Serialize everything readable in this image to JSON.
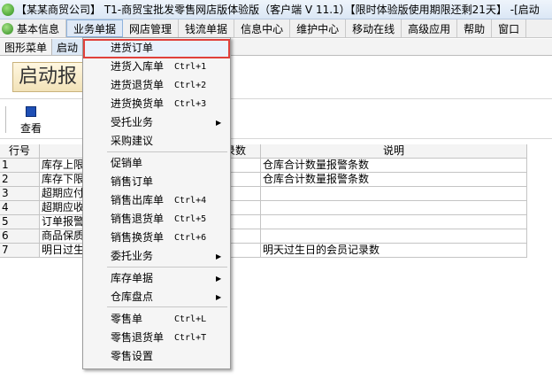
{
  "window": {
    "title": "【某某商贸公司】 T1-商贸宝批发零售网店版体验版（客户端 V 11.1）【限时体验版使用期限还剩21天】 -[启动"
  },
  "menubar": {
    "items": [
      "基本信息",
      "业务单据",
      "网店管理",
      "钱流单据",
      "信息中心",
      "维护中心",
      "移动在线",
      "高级应用",
      "帮助",
      "窗口"
    ]
  },
  "tabs": [
    "图形菜单",
    "启动"
  ],
  "banner": {
    "text": "启动报"
  },
  "toolbar": {
    "view_label": "查看"
  },
  "table": {
    "headers": {
      "row_no": "行号",
      "count": "录数",
      "desc": "说明"
    },
    "rows": [
      {
        "no": "1",
        "name": "库存上限",
        "desc": "仓库合计数量报警条数"
      },
      {
        "no": "2",
        "name": "库存下限",
        "desc": "仓库合计数量报警条数"
      },
      {
        "no": "3",
        "name": "超期应付",
        "desc": ""
      },
      {
        "no": "4",
        "name": "超期应收",
        "desc": ""
      },
      {
        "no": "5",
        "name": "订单报警",
        "desc": ""
      },
      {
        "no": "6",
        "name": "商品保质",
        "desc": ""
      },
      {
        "no": "7",
        "name": "明日过生",
        "desc": "明天过生日的会员记录数"
      }
    ]
  },
  "dropdown": {
    "items": [
      {
        "label": "进货订单",
        "shortcut": "",
        "submenu": false,
        "highlighted": true
      },
      {
        "label": "进货入库单",
        "shortcut": "Ctrl+1",
        "submenu": false
      },
      {
        "label": "进货退货单",
        "shortcut": "Ctrl+2",
        "submenu": false
      },
      {
        "label": "进货换货单",
        "shortcut": "Ctrl+3",
        "submenu": false
      },
      {
        "label": "受托业务",
        "shortcut": "",
        "submenu": true
      },
      {
        "label": "采购建议",
        "shortcut": "",
        "submenu": false
      },
      {
        "label": "促销单",
        "shortcut": "",
        "submenu": false
      },
      {
        "label": "销售订单",
        "shortcut": "",
        "submenu": false
      },
      {
        "label": "销售出库单",
        "shortcut": "Ctrl+4",
        "submenu": false
      },
      {
        "label": "销售退货单",
        "shortcut": "Ctrl+5",
        "submenu": false
      },
      {
        "label": "销售换货单",
        "shortcut": "Ctrl+6",
        "submenu": false
      },
      {
        "label": "委托业务",
        "shortcut": "",
        "submenu": true
      },
      {
        "label": "库存单据",
        "shortcut": "",
        "submenu": true
      },
      {
        "label": "仓库盘点",
        "shortcut": "",
        "submenu": true
      },
      {
        "label": "零售单",
        "shortcut": "Ctrl+L",
        "submenu": false
      },
      {
        "label": "零售退货单",
        "shortcut": "Ctrl+T",
        "submenu": false
      },
      {
        "label": "零售设置",
        "shortcut": "",
        "submenu": false
      }
    ],
    "submenu_arrow": "▶"
  },
  "colors": {
    "highlight_border": "#e0413c"
  }
}
